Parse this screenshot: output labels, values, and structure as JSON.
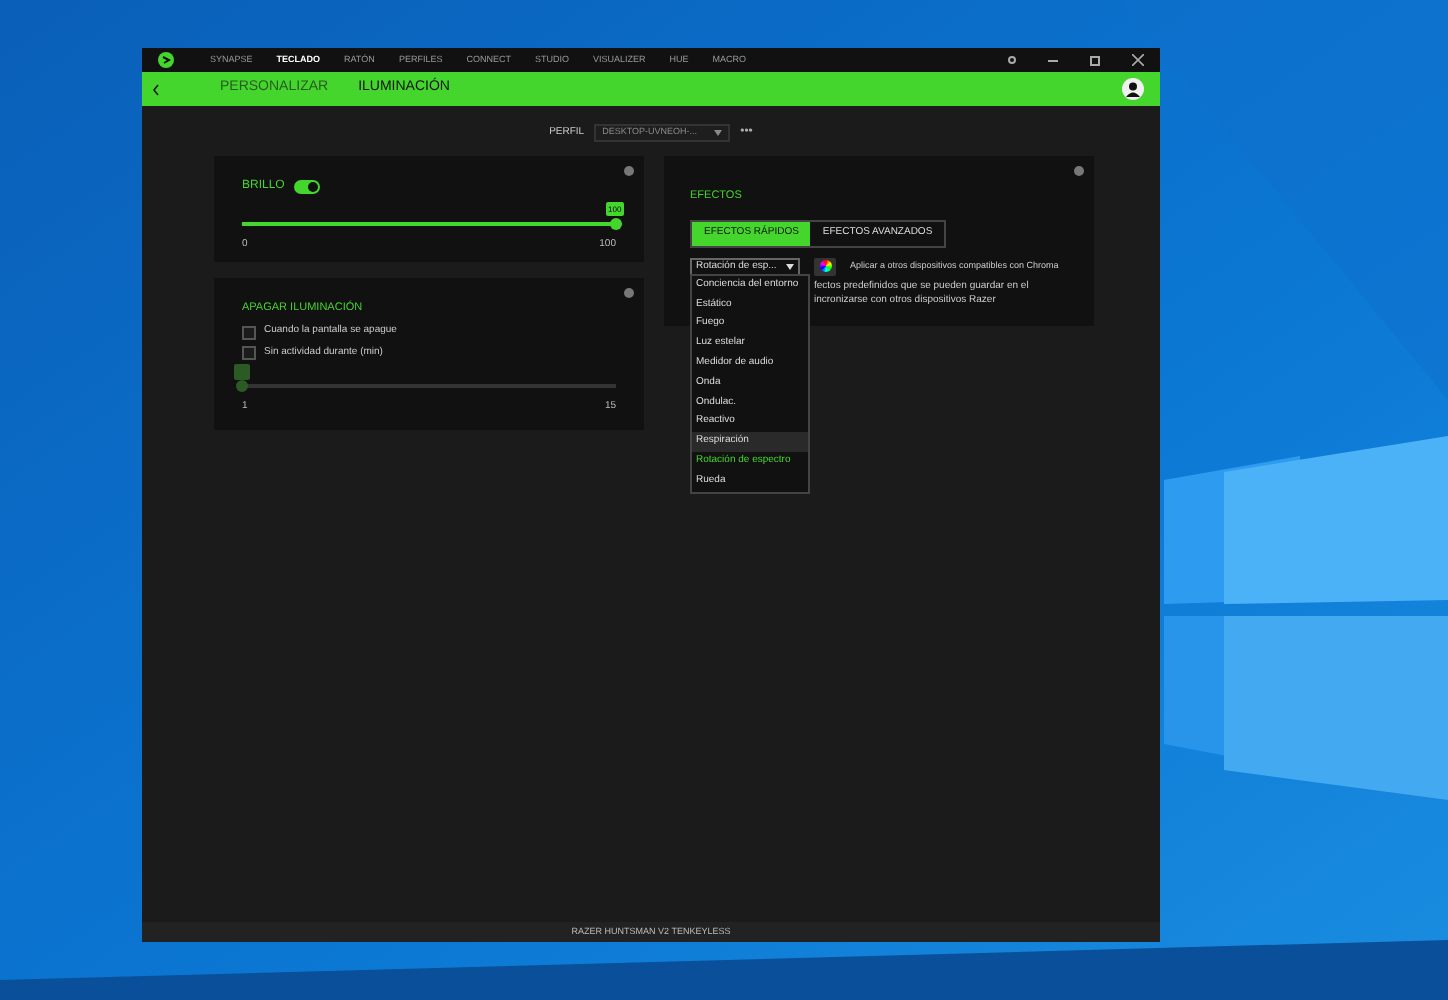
{
  "nav": [
    {
      "label": "SYNAPSE",
      "selected": false
    },
    {
      "label": "TECLADO",
      "selected": true
    },
    {
      "label": "RATÓN",
      "selected": false
    },
    {
      "label": "PERFILES",
      "selected": false
    },
    {
      "label": "CONNECT",
      "selected": false
    },
    {
      "label": "STUDIO",
      "selected": false
    },
    {
      "label": "VISUALIZER",
      "selected": false
    },
    {
      "label": "HUE",
      "selected": false
    },
    {
      "label": "MACRO",
      "selected": false
    }
  ],
  "breadcrumb": [
    {
      "label": "PERSONALIZAR",
      "selected": false
    },
    {
      "label": "ILUMINACIÓN",
      "selected": true
    }
  ],
  "profile": {
    "label": "PERFIL",
    "value": "DESKTOP-UVNEOH-...",
    "more": "•••"
  },
  "brightness": {
    "title": "BRILLO",
    "on": true,
    "level": 1,
    "bubble": "100",
    "min": "0",
    "max": "100"
  },
  "lights_off": {
    "title": "APAGAR ILUMINACIÓN",
    "options": [
      {
        "label": "Cuando la pantalla se apague",
        "checked": false
      },
      {
        "label": "Sin actividad durante (min)",
        "checked": false
      }
    ],
    "level": 0,
    "min": "1",
    "max": "15"
  },
  "effects": {
    "title": "EFECTOS",
    "tabs": [
      {
        "label": "EFECTOS RÁPIDOS",
        "selected": true
      },
      {
        "label": "EFECTOS AVANZADOS",
        "selected": false
      }
    ],
    "dropdown": {
      "value": "Rotación de esp...",
      "expanded": true,
      "options": [
        {
          "label": "Conciencia del entorno",
          "selected": false,
          "highlighted": false
        },
        {
          "label": "Estático",
          "selected": false,
          "highlighted": false
        },
        {
          "label": "Fuego",
          "selected": false,
          "highlighted": false
        },
        {
          "label": "Luz estelar",
          "selected": false,
          "highlighted": false
        },
        {
          "label": "Medidor de audio",
          "selected": false,
          "highlighted": false
        },
        {
          "label": "Onda",
          "selected": false,
          "highlighted": false
        },
        {
          "label": "Ondulac.",
          "selected": false,
          "highlighted": false
        },
        {
          "label": "Reactivo",
          "selected": false,
          "highlighted": false
        },
        {
          "label": "Respiración",
          "selected": false,
          "highlighted": true
        },
        {
          "label": "Rotación de espectro",
          "selected": true,
          "highlighted": false
        },
        {
          "label": "Rueda",
          "selected": false,
          "highlighted": false
        }
      ]
    },
    "apply": "Aplicar a otros dispositivos compatibles con Chroma",
    "description": [
      "fectos predefinidos que se pueden guardar en el",
      "incronizarse con otros dispositivos Razer"
    ]
  },
  "status_bar": "RAZER HUNTSMAN V2 TENKEYLESS"
}
